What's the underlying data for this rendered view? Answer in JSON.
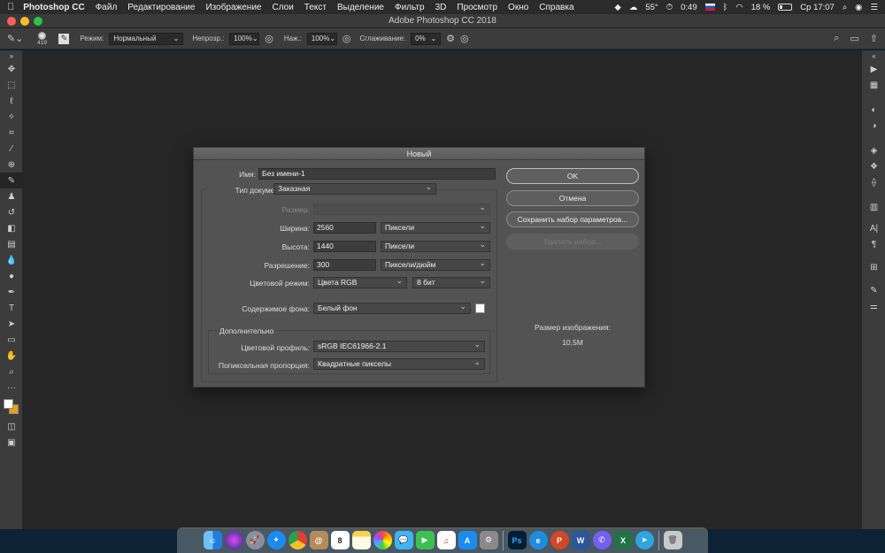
{
  "menubar": {
    "app_name": "Photoshop CC",
    "items": [
      "Файл",
      "Редактирование",
      "Изображение",
      "Слои",
      "Текст",
      "Выделение",
      "Фильтр",
      "3D",
      "Просмотр",
      "Окно",
      "Справка"
    ],
    "status": {
      "weather": "55°",
      "timer": "0:49",
      "battery": "18 %",
      "clock": "Ср 17:07"
    }
  },
  "window": {
    "title": "Adobe Photoshop CC 2018"
  },
  "options_bar": {
    "brush_size": "419",
    "mode_label": "Режим:",
    "mode_value": "Нормальный",
    "opacity_label": "Непрозр.:",
    "opacity_value": "100%",
    "flow_label": "Наж.:",
    "flow_value": "100%",
    "smoothing_label": "Сглаживание:",
    "smoothing_value": "0%"
  },
  "dialog": {
    "title": "Новый",
    "name_label": "Имя:",
    "name_value": "Без имени-1",
    "doc_type_label": "Тип документа:",
    "doc_type_value": "Заказная",
    "size_label": "Размер:",
    "width_label": "Ширина:",
    "width_value": "2560",
    "width_unit": "Пиксели",
    "height_label": "Высота:",
    "height_value": "1440",
    "height_unit": "Пиксели",
    "resolution_label": "Разрешение:",
    "resolution_value": "300",
    "resolution_unit": "Пиксели/дюйм",
    "color_mode_label": "Цветовой режим:",
    "color_mode_value": "Цвета RGB",
    "bit_depth_value": "8 бит",
    "background_label": "Содержимое фона:",
    "background_value": "Белый фон",
    "advanced_label": "Дополнительно",
    "color_profile_label": "Цветовой профиль:",
    "color_profile_value": "sRGB IEC61966-2.1",
    "pixel_aspect_label": "Попиксельная пропорция:",
    "pixel_aspect_value": "Квадратные пикселы",
    "ok_label": "OK",
    "cancel_label": "Отмена",
    "save_preset_label": "Сохранить набор параметров...",
    "delete_preset_label": "Удалить набор...",
    "image_size_label": "Размер изображения:",
    "image_size_value": "10,5M"
  },
  "colors": {
    "background_swatch": "#ffffff"
  },
  "dock": {
    "icons": [
      "finder-icon",
      "siri-icon",
      "launchpad-icon",
      "safari-icon",
      "chrome-icon",
      "contacts-icon",
      "calendar-icon",
      "notes-icon",
      "photos-icon",
      "messages-icon",
      "facetime-icon",
      "music-icon",
      "appstore-icon",
      "preferences-icon",
      "photoshop-icon",
      "edge-icon",
      "powerpoint-icon",
      "word-icon",
      "viber-icon",
      "excel-icon",
      "telegram-icon",
      "trash-icon"
    ],
    "calendar_day": "8"
  }
}
